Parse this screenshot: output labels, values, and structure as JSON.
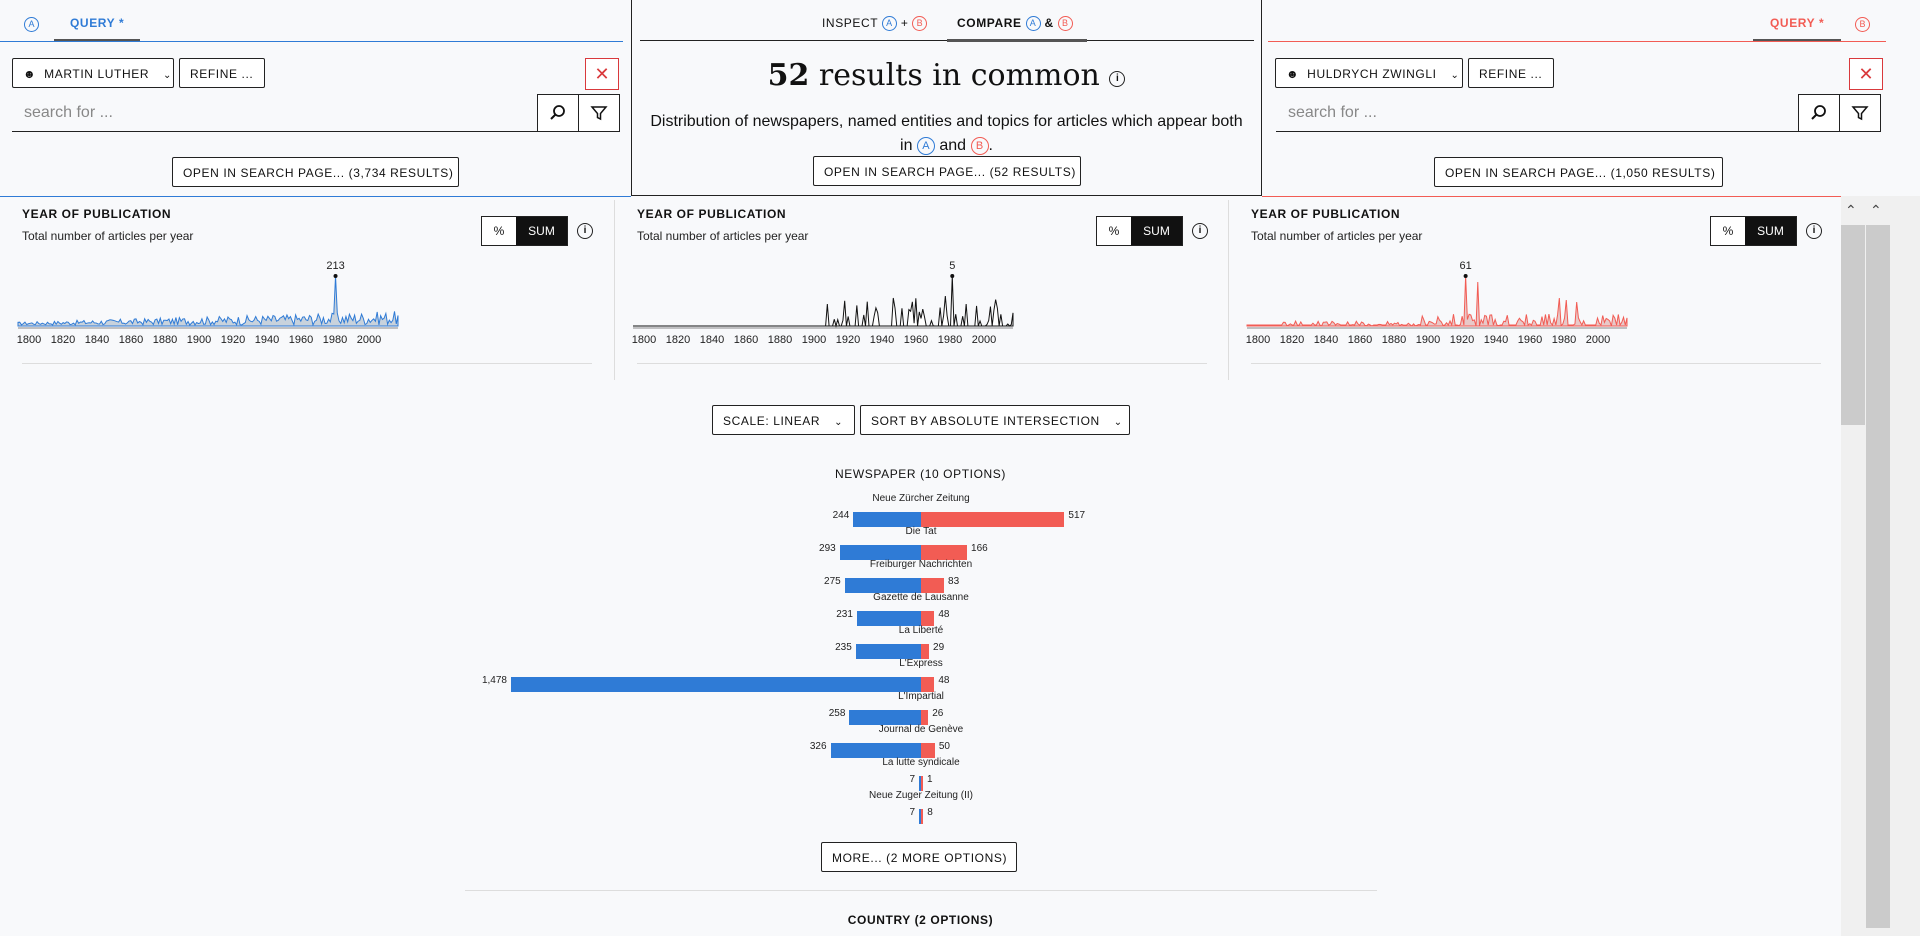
{
  "colors": {
    "a": "#2f7bd6",
    "b": "#f25c54",
    "dark": "#111111"
  },
  "panel_a": {
    "badge": "A",
    "tab": "QUERY *",
    "person": "MARTIN LUTHER",
    "refine": "REFINE ...",
    "search_placeholder": "search for ...",
    "open": "OPEN IN SEARCH PAGE... (3,734 RESULTS)"
  },
  "panel_b": {
    "badge": "B",
    "tab": "QUERY *",
    "person": "HULDRYCH ZWINGLI",
    "refine": "REFINE ...",
    "search_placeholder": "search for ...",
    "open": "OPEN IN SEARCH PAGE... (1,050 RESULTS)"
  },
  "center": {
    "inspect": "INSPECT",
    "plus": "+",
    "compare": "COMPARE",
    "amp": "&",
    "headline_number": "52",
    "headline_text": "results in common",
    "desc_line1": "Distribution of newspapers, named entities and topics for articles which appear both",
    "desc_in": "in",
    "desc_and": "and",
    "desc_end": ".",
    "open": "OPEN IN SEARCH PAGE... (52 RESULTS)"
  },
  "year_panels": [
    {
      "title": "YEAR OF PUBLICATION",
      "subtitle": "Total number of articles per year",
      "pct": "%",
      "sum": "SUM",
      "peak_label": "213",
      "ticks": [
        "1800",
        "1820",
        "1840",
        "1860",
        "1880",
        "1900",
        "1920",
        "1940",
        "1960",
        "1980",
        "2000"
      ]
    },
    {
      "title": "YEAR OF PUBLICATION",
      "subtitle": "Total number of articles per year",
      "pct": "%",
      "sum": "SUM",
      "peak_label": "5",
      "ticks": [
        "1800",
        "1820",
        "1840",
        "1860",
        "1880",
        "1900",
        "1920",
        "1940",
        "1960",
        "1980",
        "2000"
      ]
    },
    {
      "title": "YEAR OF PUBLICATION",
      "subtitle": "Total number of articles per year",
      "pct": "%",
      "sum": "SUM",
      "peak_label": "61",
      "ticks": [
        "1800",
        "1820",
        "1840",
        "1860",
        "1880",
        "1900",
        "1920",
        "1940",
        "1960",
        "1980",
        "2000"
      ]
    }
  ],
  "controls": {
    "scale": "SCALE: LINEAR",
    "sort": "SORT BY ABSOLUTE INTERSECTION"
  },
  "newspaper": {
    "title": "NEWSPAPER (10 OPTIONS)",
    "rows": [
      {
        "name": "Neue Zürcher Zeitung",
        "a": 244,
        "a_label": "244",
        "b": 517,
        "b_label": "517"
      },
      {
        "name": "Die Tat",
        "a": 293,
        "a_label": "293",
        "b": 166,
        "b_label": "166"
      },
      {
        "name": "Freiburger Nachrichten",
        "a": 275,
        "a_label": "275",
        "b": 83,
        "b_label": "83"
      },
      {
        "name": "Gazette de Lausanne",
        "a": 231,
        "a_label": "231",
        "b": 48,
        "b_label": "48"
      },
      {
        "name": "La Liberté",
        "a": 235,
        "a_label": "235",
        "b": 29,
        "b_label": "29"
      },
      {
        "name": "L'Express",
        "a": 1478,
        "a_label": "1,478",
        "b": 48,
        "b_label": "48"
      },
      {
        "name": "L'Impartial",
        "a": 258,
        "a_label": "258",
        "b": 26,
        "b_label": "26"
      },
      {
        "name": "Journal de Genève",
        "a": 326,
        "a_label": "326",
        "b": 50,
        "b_label": "50"
      },
      {
        "name": "La lutte syndicale",
        "a": 7,
        "a_label": "7",
        "b": 1,
        "b_label": "1"
      },
      {
        "name": "Neue Zuger Zeitung (II)",
        "a": 7,
        "a_label": "7",
        "b": 8,
        "b_label": "8"
      }
    ],
    "more": "MORE... (2 MORE OPTIONS)"
  },
  "country": {
    "title": "COUNTRY (2 OPTIONS)"
  }
}
